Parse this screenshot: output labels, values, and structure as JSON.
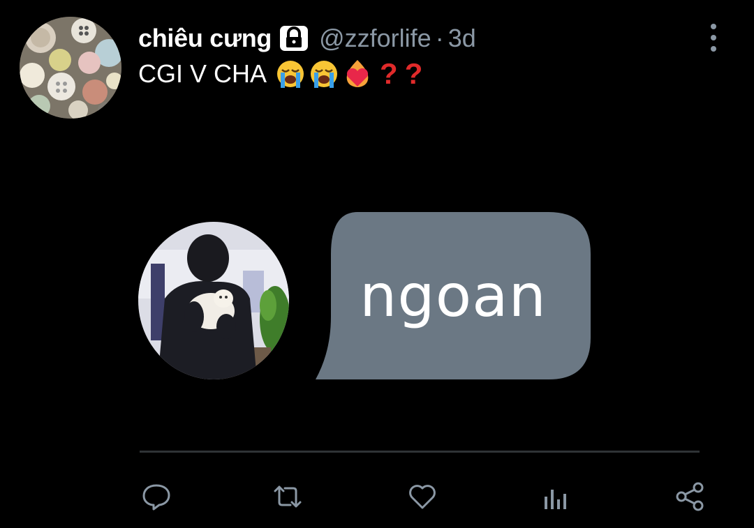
{
  "tweet": {
    "display_name": "chiêu cưng",
    "handle": "@zzforlife",
    "separator": "·",
    "time": "3d",
    "text": "CGI V CHA",
    "emojis": [
      "loudly-crying-face-emoji",
      "loudly-crying-face-emoji",
      "heart-on-fire-emoji",
      "red-question-mark-emoji",
      "red-question-mark-emoji"
    ],
    "question_marks": [
      "?",
      "?"
    ]
  },
  "media": {
    "bubble_text": "ngoan",
    "bubble_color": "#6b7884"
  },
  "icons": {
    "lock": "lock-icon",
    "more": "more-options-icon",
    "reply": "reply-icon",
    "retweet": "retweet-icon",
    "like": "like-icon",
    "analytics": "analytics-icon",
    "share": "share-icon"
  },
  "colors": {
    "background": "#000000",
    "secondary_text": "#8b98a5",
    "divider": "#2f3336"
  }
}
